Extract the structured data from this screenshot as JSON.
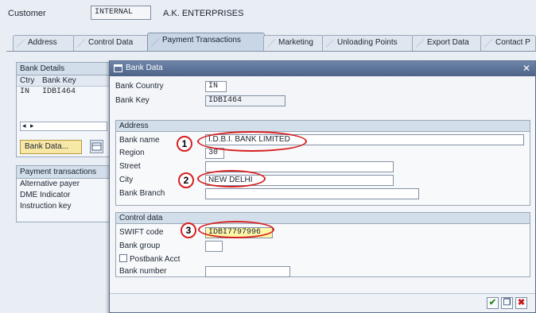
{
  "header": {
    "customer_label": "Customer",
    "customer_type": "INTERNAL",
    "customer_name": "A.K. ENTERPRISES"
  },
  "tabs": [
    {
      "label": "Address"
    },
    {
      "label": "Control Data"
    },
    {
      "label": "Payment Transactions",
      "active": true
    },
    {
      "label": "Marketing"
    },
    {
      "label": "Unloading Points"
    },
    {
      "label": "Export Data"
    },
    {
      "label": "Contact P"
    }
  ],
  "bank_details": {
    "title": "Bank Details",
    "columns": [
      "Ctry",
      "Bank Key"
    ],
    "rows": [
      [
        "IN",
        "IDBI464"
      ]
    ],
    "bank_data_button": "Bank Data..."
  },
  "payment_transactions": {
    "title": "Payment transactions",
    "rows": [
      "Alternative payer",
      "DME Indicator",
      "Instruction key"
    ]
  },
  "popup": {
    "title": "Bank Data",
    "bank_country_label": "Bank Country",
    "bank_country_value": "IN",
    "bank_key_label": "Bank Key",
    "bank_key_value": "IDBI464",
    "address": {
      "title": "Address",
      "bank_name_label": "Bank name",
      "bank_name_value": "I.D.B.I. BANK LIMITED",
      "region_label": "Region",
      "region_value": "30",
      "street_label": "Street",
      "street_value": "",
      "city_label": "City",
      "city_value": "NEW DELHI",
      "bank_branch_label": "Bank Branch",
      "bank_branch_value": ""
    },
    "control": {
      "title": "Control data",
      "swift_label": "SWIFT code",
      "swift_value": "IDBI7797996",
      "bank_group_label": "Bank group",
      "bank_group_value": "",
      "postbank_label": "Postbank Acct",
      "bank_number_label": "Bank number",
      "bank_number_value": ""
    },
    "callouts": [
      "1",
      "2",
      "3"
    ]
  },
  "colors": {
    "accent_red": "#d81f1f",
    "title_bar": "#4c6287",
    "highlight": "#fff7a8"
  }
}
